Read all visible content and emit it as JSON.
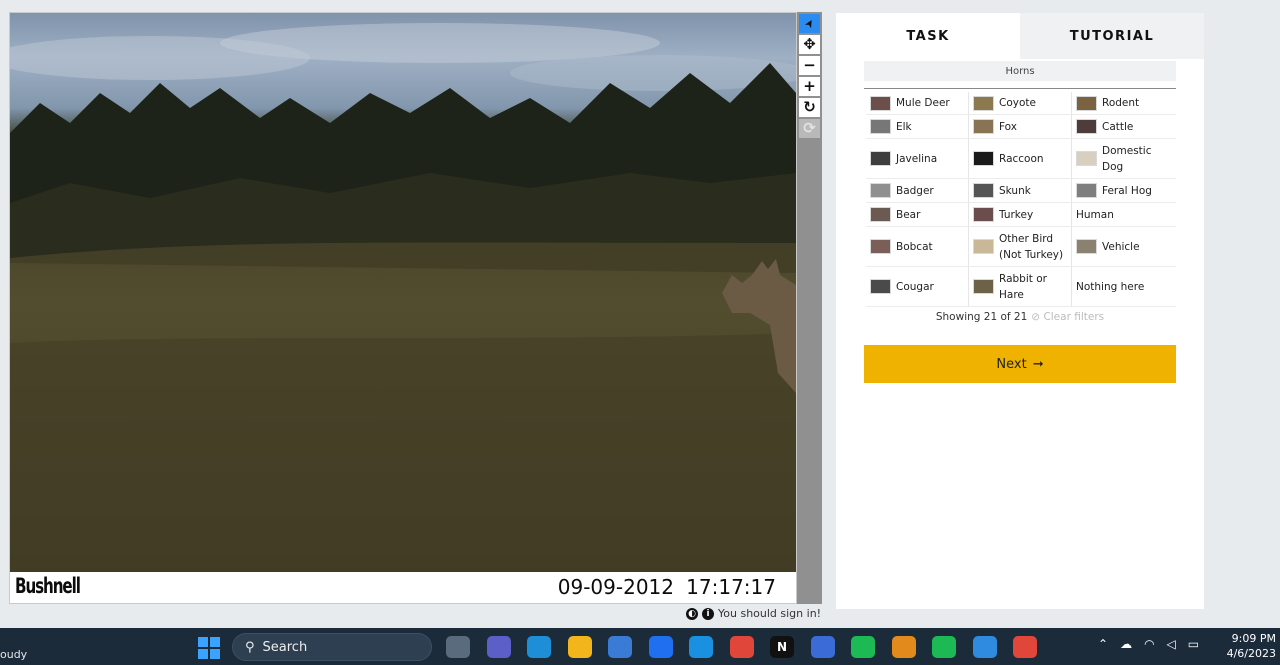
{
  "viewer": {
    "brand": "Bushnell",
    "date": "09-09-2012",
    "time": "17:17:17",
    "signin_text": "You should sign in!"
  },
  "toolbar": {
    "tools": [
      {
        "name": "pointer",
        "glyph": "➤"
      },
      {
        "name": "move",
        "glyph": "✥"
      },
      {
        "name": "zoom-out",
        "glyph": "−"
      },
      {
        "name": "zoom-in",
        "glyph": "+"
      },
      {
        "name": "rotate",
        "glyph": "↻"
      },
      {
        "name": "reset",
        "glyph": "⟳"
      }
    ]
  },
  "panel": {
    "tabs": {
      "task": "TASK",
      "tutorial": "TUTORIAL"
    },
    "filter_label": "Horns",
    "species": [
      {
        "label": "Mule Deer",
        "thumb": "#6c4f4a"
      },
      {
        "label": "Coyote",
        "thumb": "#8c7a4e"
      },
      {
        "label": "Rodent",
        "thumb": "#7a6242"
      },
      {
        "label": "Elk",
        "thumb": "#777777"
      },
      {
        "label": "Fox",
        "thumb": "#8a7354"
      },
      {
        "label": "Cattle",
        "thumb": "#4d3c3a"
      },
      {
        "label": "Javelina",
        "thumb": "#3e3e3e"
      },
      {
        "label": "Raccoon",
        "thumb": "#1a1a1a"
      },
      {
        "label": "Domestic Dog",
        "thumb": "#d8cfc0"
      },
      {
        "label": "Badger",
        "thumb": "#8f8f8f"
      },
      {
        "label": "Skunk",
        "thumb": "#555555"
      },
      {
        "label": "Feral Hog",
        "thumb": "#7f7f7f"
      },
      {
        "label": "Bear",
        "thumb": "#6a5a52"
      },
      {
        "label": "Turkey",
        "thumb": "#6b4d4d"
      },
      {
        "label": "Human",
        "thumb": ""
      },
      {
        "label": "Bobcat",
        "thumb": "#7b5e57"
      },
      {
        "label": "Other Bird (Not Turkey)",
        "thumb": "#c8b898"
      },
      {
        "label": "Vehicle",
        "thumb": "#8a8170"
      },
      {
        "label": "Cougar",
        "thumb": "#4a4a4a"
      },
      {
        "label": "Rabbit or Hare",
        "thumb": "#6d6248"
      },
      {
        "label": "Nothing here",
        "thumb": ""
      }
    ],
    "showing": "Showing 21 of 21",
    "clear_filters": "Clear filters",
    "next_label": "Next"
  },
  "taskbar": {
    "weather": "oudy",
    "search_label": "Search",
    "apps": [
      {
        "name": "task-view",
        "color": "#5a6b7d",
        "glyph": ""
      },
      {
        "name": "teams",
        "color": "#5b5fc7",
        "glyph": ""
      },
      {
        "name": "edge",
        "color": "#1e8fd6",
        "glyph": ""
      },
      {
        "name": "file-explorer",
        "color": "#f2b61c",
        "glyph": ""
      },
      {
        "name": "store",
        "color": "#3a7bd5",
        "glyph": ""
      },
      {
        "name": "dropbox",
        "color": "#1f6ff0",
        "glyph": ""
      },
      {
        "name": "mail",
        "color": "#1a90e0",
        "glyph": ""
      },
      {
        "name": "chrome",
        "color": "#e0473a",
        "glyph": ""
      },
      {
        "name": "netflix",
        "color": "#111111",
        "glyph": "N"
      },
      {
        "name": "app",
        "color": "#3b6bd6",
        "glyph": ""
      },
      {
        "name": "spotify",
        "color": "#1db954",
        "glyph": ""
      },
      {
        "name": "sublime",
        "color": "#e28a1c",
        "glyph": ""
      },
      {
        "name": "spotify-2",
        "color": "#1db954",
        "glyph": ""
      },
      {
        "name": "app-2",
        "color": "#2f8be0",
        "glyph": ""
      },
      {
        "name": "chrome-2",
        "color": "#e0473a",
        "glyph": ""
      }
    ],
    "time": "9:09 PM",
    "date": "4/6/2023"
  }
}
